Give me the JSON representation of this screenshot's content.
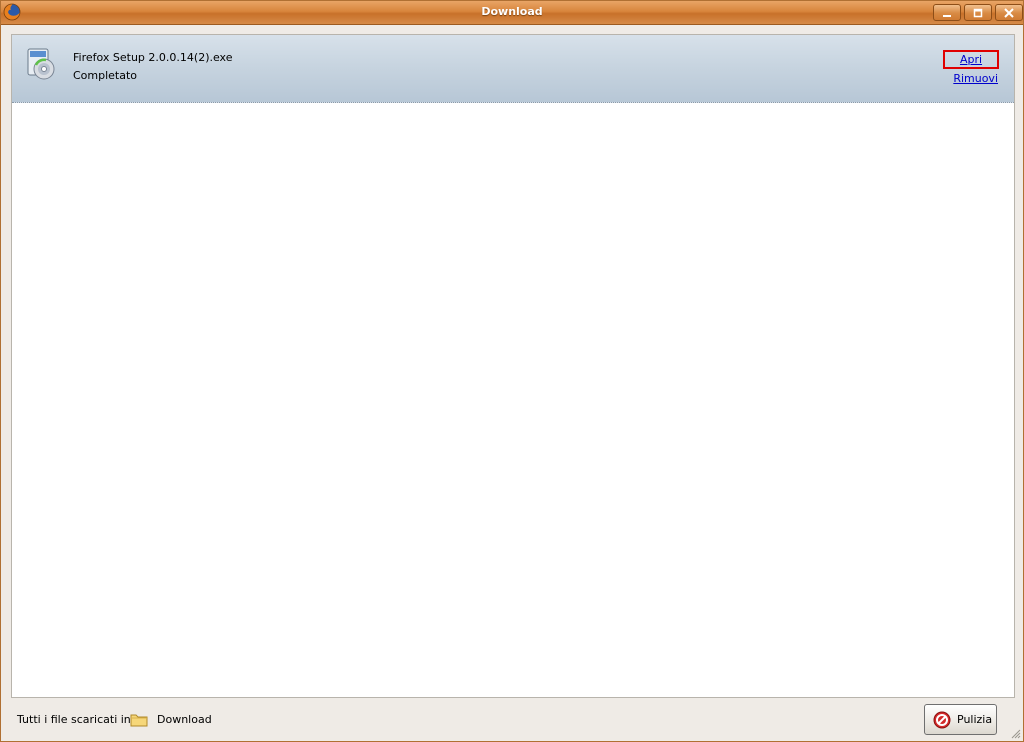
{
  "window": {
    "title": "Download"
  },
  "titlebar": {
    "buttons": [
      "minimize",
      "maximize",
      "close"
    ]
  },
  "downloads": [
    {
      "file_name": "Firefox Setup 2.0.0.14(2).exe",
      "status": "Completato",
      "open_label": "Apri",
      "remove_label": "Rimuovi",
      "icon": "installer-cd-icon"
    }
  ],
  "footer": {
    "label": "Tutti i file scaricati in:",
    "folder_name": "Download",
    "clean_button_label": "Pulizia"
  },
  "colors": {
    "titlebar": "#d8853c",
    "item_highlight": "#c6d3df",
    "link": "#0000cc",
    "focus_outline": "#e00000"
  }
}
